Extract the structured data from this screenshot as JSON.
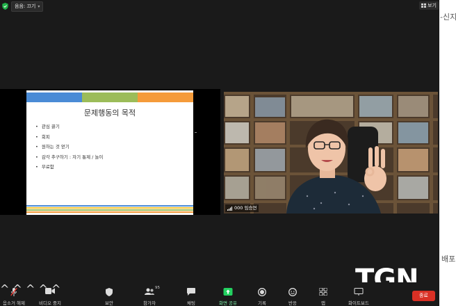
{
  "top_bar": {
    "audio_label": "음음: 끄기",
    "view_label": "보기"
  },
  "right_edge": {
    "top_text": "-신지",
    "bottom_text": "배포"
  },
  "slide": {
    "title": "문제행동의 목적",
    "bullets": [
      "관심 끌기",
      "회피",
      "원하는 것 얻기",
      "감각 추구하기 : 자기 통제 / 놀이",
      "무료함"
    ],
    "header_colors": [
      "#4a8bd6",
      "#9cbc59",
      "#f59b3a"
    ]
  },
  "camera": {
    "name_tag": "000 임승연"
  },
  "toolbar": {
    "mic_label": "음소거 해제",
    "video_label": "비디오 중지",
    "security_label": "보안",
    "participants_label": "참가자",
    "participants_count": "95",
    "chat_label": "채팅",
    "share_label": "화면 공유",
    "record_label": "기록",
    "reactions_label": "반응",
    "apps_label": "앱",
    "whiteboard_label": "화이트보드",
    "end_label": "종료",
    "share_color": "#23d160",
    "end_color": "#d93025"
  },
  "watermark": {
    "text": "TGN"
  }
}
